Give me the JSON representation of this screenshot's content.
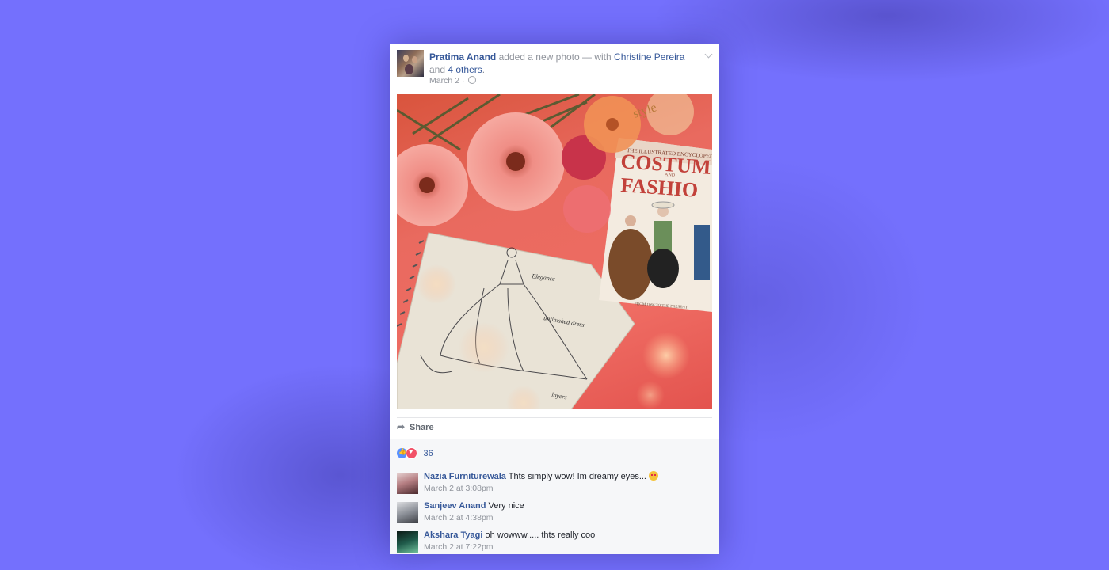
{
  "post": {
    "author": "Pratima Anand",
    "action": "added a new photo — with",
    "tagged": "Christine Pereira",
    "and_text": "and",
    "others": "4 others",
    "period": ".",
    "date": "March 2",
    "date_sep": "·",
    "privacy_icon": "globe-icon",
    "photo_book": {
      "title_top": "THE ILLUSTRATED ENCYCLOPEDIA",
      "title_main_1": "COSTUM",
      "title_and": "AND",
      "title_main_2": "FASHIO",
      "footer": "FROM 1066 TO THE PRESENT"
    },
    "photo_sketch_note_1": "Elegance",
    "photo_sketch_note_2": "unfinished dress",
    "photo_sketch_note_3": "layers",
    "photo_style_text": "style"
  },
  "actions": {
    "share_label": "Share",
    "share_icon": "share-arrow-icon"
  },
  "reactions": {
    "count": "36",
    "icons": [
      "like-icon",
      "love-icon"
    ]
  },
  "comments": [
    {
      "name": "Nazia Furniturewala",
      "text": "Thts simply wow! Im dreamy eyes...",
      "emoji": "heart-eyes-emoji",
      "time": "March 2 at 3:08pm",
      "avatar_color": "#b67f83"
    },
    {
      "name": "Sanjeev Anand",
      "text": "Very nice",
      "time": "March 2 at 4:38pm",
      "avatar_color": "#8c9098"
    },
    {
      "name": "Akshara Tyagi",
      "text": "oh wowww..... thts really cool",
      "time": "March 2 at 7:22pm",
      "avatar_color": "#1f5a4a"
    }
  ],
  "colors": {
    "background": "#7470fd",
    "link": "#365899",
    "meta": "#90949c"
  }
}
